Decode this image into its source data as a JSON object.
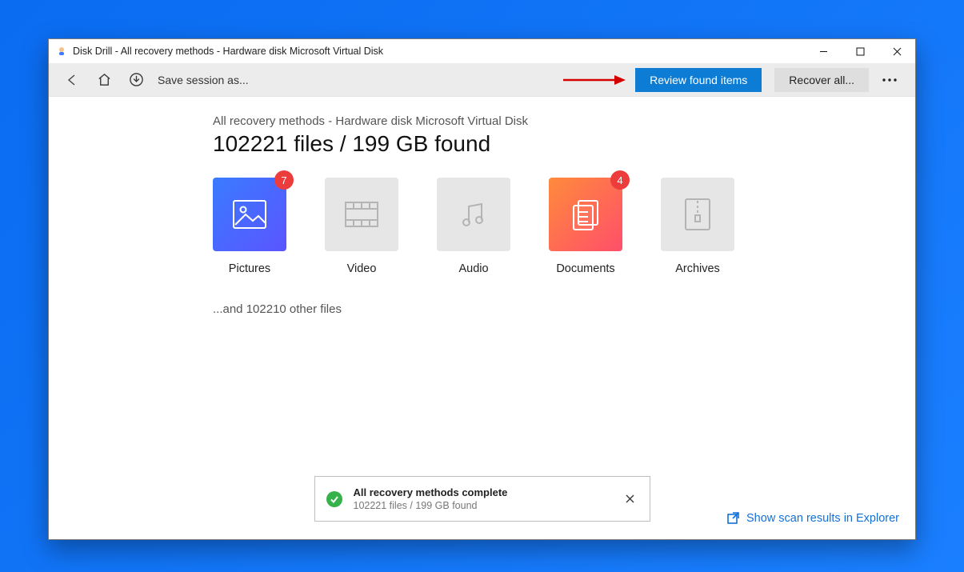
{
  "window": {
    "title": "Disk Drill - All recovery methods - Hardware disk Microsoft Virtual Disk"
  },
  "toolbar": {
    "save_session": "Save session as...",
    "review_btn": "Review found items",
    "recover_btn": "Recover all..."
  },
  "main": {
    "path": "All recovery methods - Hardware disk Microsoft Virtual Disk",
    "summary": "102221 files / 199 GB found",
    "more_files": "...and 102210 other files",
    "categories": [
      {
        "label": "Pictures",
        "badge": "7",
        "style": "blue"
      },
      {
        "label": "Video",
        "badge": "",
        "style": "gray"
      },
      {
        "label": "Audio",
        "badge": "",
        "style": "gray"
      },
      {
        "label": "Documents",
        "badge": "4",
        "style": "orange"
      },
      {
        "label": "Archives",
        "badge": "",
        "style": "gray"
      }
    ]
  },
  "toast": {
    "title": "All recovery methods complete",
    "sub": "102221 files / 199 GB found"
  },
  "footer": {
    "explorer_link": "Show scan results in Explorer"
  }
}
